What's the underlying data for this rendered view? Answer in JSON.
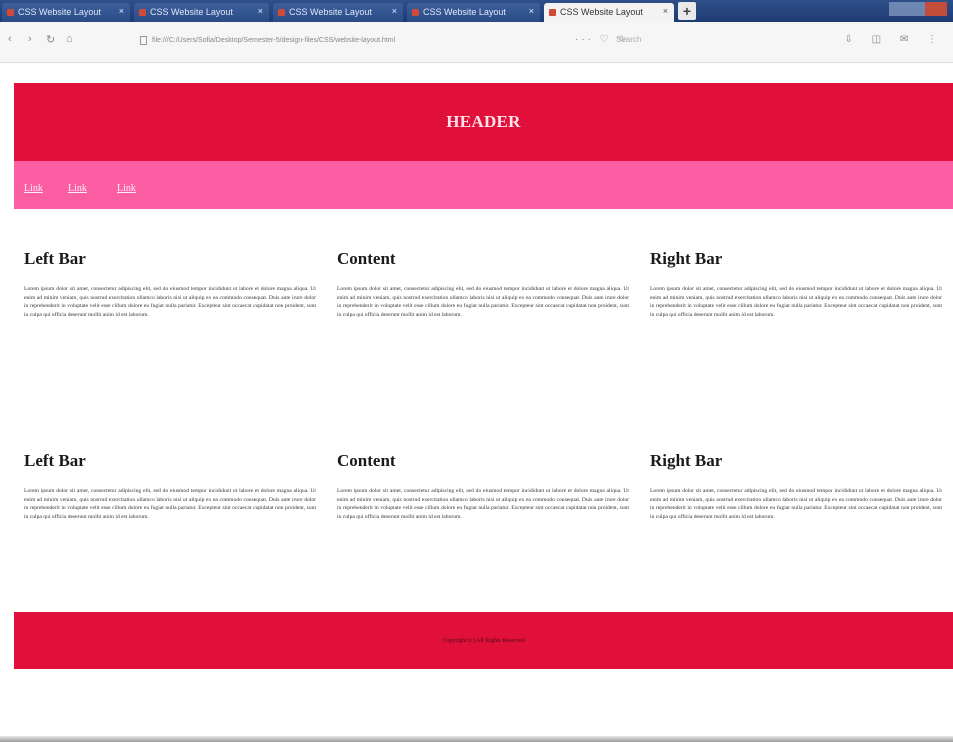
{
  "browser": {
    "tabs": [
      {
        "label": "CSS Website Layout"
      },
      {
        "label": "CSS Website Layout"
      },
      {
        "label": "CSS Website Layout"
      },
      {
        "label": "CSS Website Layout"
      },
      {
        "label": "CSS Website Layout"
      }
    ],
    "tab_close": "×",
    "new_tab": "+",
    "url": "file:///C:/Users/Sofia/Desktop/Semester-5/design-files/CSS/website-layout.html",
    "search_placeholder": "Search",
    "nav_back": "‹",
    "nav_forward": "›",
    "nav_reload": "↻",
    "nav_home": "⌂",
    "url_actions": "··· ♡ ☆",
    "tool_icons": "⇩ ◫ ✉ ⋮"
  },
  "header": {
    "title": "HEADER"
  },
  "nav": {
    "links": [
      "Link",
      "Link",
      "Link"
    ]
  },
  "rows": [
    {
      "columns": [
        {
          "title": "Left Bar",
          "text": "Lorem ipsum dolor sit amet, consectetur adipiscing elit, sed do eiusmod tempor incididunt ut labore et dolore magna aliqua. Ut enim ad minim veniam, quis nostrud exercitation ullamco laboris nisi ut aliquip ex ea commodo consequat. Duis aute irure dolor in reprehenderit in voluptate velit esse cillum dolore eu fugiat nulla pariatur. Excepteur sint occaecat cupidatat non proident, sunt in culpa qui officia deserunt mollit anim id est laborum."
        },
        {
          "title": "Content",
          "text": "Lorem ipsum dolor sit amet, consectetur adipiscing elit, sed do eiusmod tempor incididunt ut labore et dolore magna aliqua. Ut enim ad minim veniam, quis nostrud exercitation ullamco laboris nisi ut aliquip ex ea commodo consequat. Duis aute irure dolor in reprehenderit in voluptate velit esse cillum dolore eu fugiat nulla pariatur. Excepteur sint occaecat cupidatat non proident, sunt in culpa qui officia deserunt mollit anim id est laborum."
        },
        {
          "title": "Right Bar",
          "text": "Lorem ipsum dolor sit amet, consectetur adipiscing elit, sed do eiusmod tempor incididunt ut labore et dolore magna aliqua. Ut enim ad minim veniam, quis nostrud exercitation ullamco laboris nisi ut aliquip ex ea commodo consequat. Duis aute irure dolor in reprehenderit in voluptate velit esse cillum dolore eu fugiat nulla pariatur. Excepteur sint occaecat cupidatat non proident, sunt in culpa qui officia deserunt mollit anim id est laborum."
        }
      ]
    },
    {
      "columns": [
        {
          "title": "Left Bar",
          "text": "Lorem ipsum dolor sit amet, consectetur adipiscing elit, sed do eiusmod tempor incididunt ut labore et dolore magna aliqua. Ut enim ad minim veniam, quis nostrud exercitation ullamco laboris nisi ut aliquip ex ea commodo consequat. Duis aute irure dolor in reprehenderit in voluptate velit esse cillum dolore eu fugiat nulla pariatur. Excepteur sint occaecat cupidatat non proident, sunt in culpa qui officia deserunt mollit anim id est laborum."
        },
        {
          "title": "Content",
          "text": "Lorem ipsum dolor sit amet, consectetur adipiscing elit, sed do eiusmod tempor incididunt ut labore et dolore magna aliqua. Ut enim ad minim veniam, quis nostrud exercitation ullamco laboris nisi ut aliquip ex ea commodo consequat. Duis aute irure dolor in reprehenderit in voluptate velit esse cillum dolore eu fugiat nulla pariatur. Excepteur sint occaecat cupidatat non proident, sunt in culpa qui officia deserunt mollit anim id est laborum."
        },
        {
          "title": "Right Bar",
          "text": "Lorem ipsum dolor sit amet, consectetur adipiscing elit, sed do eiusmod tempor incididunt ut labore et dolore magna aliqua. Ut enim ad minim veniam, quis nostrud exercitation ullamco laboris nisi ut aliquip ex ea commodo consequat. Duis aute irure dolor in reprehenderit in voluptate velit esse cillum dolore eu fugiat nulla pariatur. Excepteur sint occaecat cupidatat non proident, sunt in culpa qui officia deserunt mollit anim id est laborum."
        }
      ]
    }
  ],
  "footer": {
    "text": "Copyright (c) All Rights Reserved"
  },
  "colors": {
    "header": "#e0103b",
    "nav": "#fb5ea3",
    "footer": "#e0103b"
  }
}
